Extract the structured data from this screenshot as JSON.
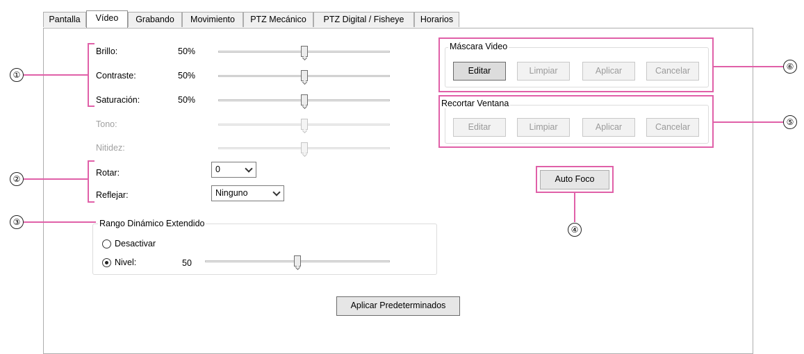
{
  "tabs": [
    "Pantalla",
    "Vídeo",
    "Grabando",
    "Movimiento",
    "PTZ Mecánico",
    "PTZ Digital / Fisheye",
    "Horarios"
  ],
  "active_tab": "Vídeo",
  "image": {
    "brillo": {
      "label": "Brillo:",
      "value": "50%",
      "level": 0.5
    },
    "contraste": {
      "label": "Contraste:",
      "value": "50%",
      "level": 0.5
    },
    "saturacion": {
      "label": "Saturación:",
      "value": "50%",
      "level": 0.5
    },
    "tono": {
      "label": "Tono:",
      "level": 0.5
    },
    "nitidez": {
      "label": "Nitidez:",
      "level": 0.5
    }
  },
  "rotar": {
    "label": "Rotar:",
    "value": "0"
  },
  "reflejar": {
    "label": "Reflejar:",
    "value": "Ninguno"
  },
  "wdr": {
    "title": "Rango Dinámico Extendido",
    "desactivar": "Desactivar",
    "nivel": "Nivel:",
    "nivel_value": "50",
    "level": 0.5
  },
  "mascara": {
    "title": "Máscara Video",
    "buttons": [
      "Editar",
      "Limpiar",
      "Aplicar",
      "Cancelar"
    ]
  },
  "recortar": {
    "title": "Recortar Ventana",
    "buttons": [
      "Editar",
      "Limpiar",
      "Aplicar",
      "Cancelar"
    ]
  },
  "auto_foco": "Auto Foco",
  "aplicar_predeterminados": "Aplicar Predeterminados",
  "callouts": [
    "①",
    "②",
    "③",
    "④",
    "⑤",
    "⑥"
  ],
  "colors": {
    "callout": "#e060a8"
  }
}
